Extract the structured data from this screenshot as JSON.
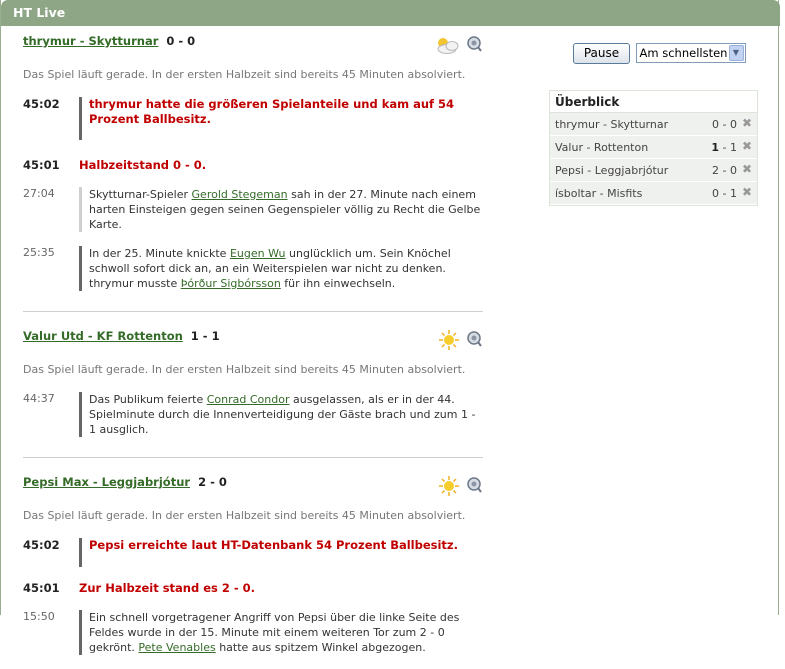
{
  "window": {
    "title": "HT Live"
  },
  "controls": {
    "pause_label": "Pause",
    "speed_selected": "Am schnellsten",
    "speed_arrow": "▼"
  },
  "overview": {
    "title": "Überblick",
    "matches": [
      {
        "name": "thrymur - Skytturnar",
        "score": "0 - 0"
      },
      {
        "name": "Valur - Rottenton",
        "score_home": "1",
        "score_rest": " - 1"
      },
      {
        "name": "Pepsi - Leggjabrjótur",
        "score": "2 - 0"
      },
      {
        "name": "ísboltar - Misfits",
        "score": "0 - 1"
      }
    ],
    "remove_icon": "✖"
  },
  "feed": {
    "matches": [
      {
        "title": "thrymur - Skytturnar",
        "score": "0 - 0",
        "weather": "partly-cloudy-icon",
        "status": "Das Spiel läuft gerade. In der ersten Halbzeit sind bereits 45 Minuten absolviert.",
        "events": [
          {
            "time": "45:02",
            "text": "thrymur hatte die größeren Spielanteile und kam auf 54 Prozent Ballbesitz."
          },
          {
            "time": "45:01",
            "text": "Halbzeitstand 0 - 0."
          },
          {
            "time": "27:04",
            "pre": "Skytturnar-Spieler ",
            "link": "Gerold Stegeman",
            "post": " sah in der 27. Minute nach einem harten Einsteigen gegen seinen Gegenspieler völlig zu Recht die Gelbe Karte."
          },
          {
            "time": "25:35",
            "pre": "In der 25. Minute knickte ",
            "link": "Eugen Wu",
            "mid": " unglücklich um. Sein Knöchel schwoll sofort dick an, an ein Weiterspielen war nicht zu denken. thrymur musste ",
            "link2": "Þórður Sigbórsson",
            "post": " für ihn einwechseln."
          }
        ]
      },
      {
        "title": "Valur Utd - KF Rottenton",
        "score": "1 - 1",
        "weather": "sun-icon",
        "status": "Das Spiel läuft gerade. In der ersten Halbzeit sind bereits 45 Minuten absolviert.",
        "events": [
          {
            "time": "44:37",
            "pre": "Das Publikum feierte ",
            "link": "Conrad Condor",
            "post": " ausgelassen, als er in der 44. Spielminute durch die Innenverteidigung der Gäste brach und zum 1 - 1 ausglich."
          }
        ]
      },
      {
        "title": "Pepsi Max - Leggjabrjótur",
        "score": "2 - 0",
        "weather": "sun-icon",
        "status": "Das Spiel läuft gerade. In der ersten Halbzeit sind bereits 45 Minuten absolviert.",
        "events": [
          {
            "time": "45:02",
            "text": "Pepsi erreichte laut HT-Datenbank 54 Prozent Ballbesitz."
          },
          {
            "time": "45:01",
            "text": "Zur Halbzeit stand es 2 - 0."
          },
          {
            "time": "15:50",
            "pre": "Ein schnell vorgetragener Angriff von Pepsi über die linke Seite des Feldes wurde in der 15. Minute mit einem weiteren Tor zum 2 - 0 gekrönt. ",
            "link": "Pete Venables",
            "post": " hatte aus spitzem Winkel abgezogen."
          }
        ]
      }
    ]
  }
}
